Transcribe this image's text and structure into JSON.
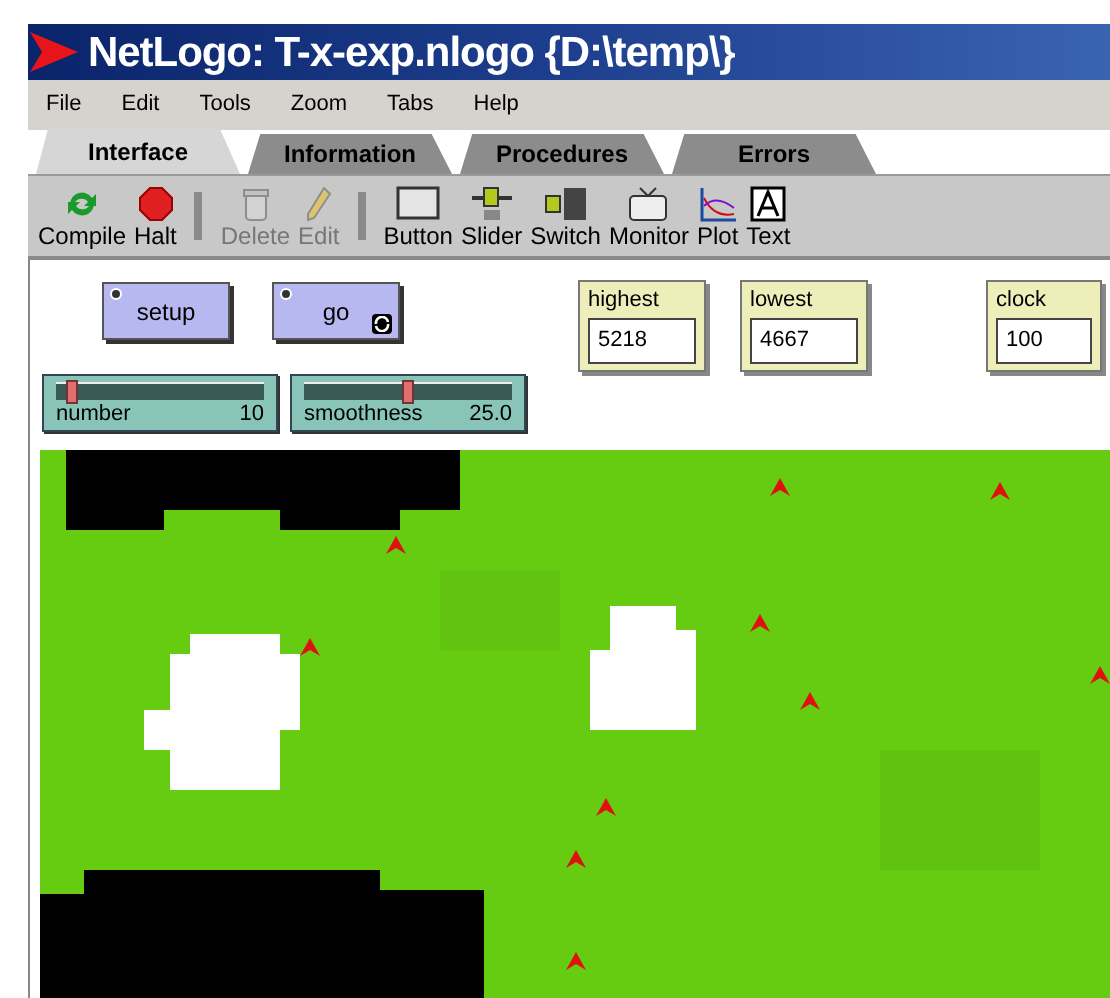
{
  "window": {
    "title": "NetLogo: T-x-exp.nlogo {D:\\temp\\}"
  },
  "menu": [
    "File",
    "Edit",
    "Tools",
    "Zoom",
    "Tabs",
    "Help"
  ],
  "tabs": [
    {
      "label": "Interface",
      "selected": true
    },
    {
      "label": "Information",
      "selected": false
    },
    {
      "label": "Procedures",
      "selected": false
    },
    {
      "label": "Errors",
      "selected": false
    }
  ],
  "toolbar_groups": [
    {
      "items": [
        {
          "label": "Compile",
          "disabled": false
        },
        {
          "label": "Halt",
          "disabled": false
        }
      ]
    },
    {
      "items": [
        {
          "label": "Delete",
          "disabled": true
        },
        {
          "label": "Edit",
          "disabled": true
        }
      ]
    },
    {
      "items": [
        {
          "label": "Button",
          "disabled": false
        },
        {
          "label": "Slider",
          "disabled": false
        },
        {
          "label": "Switch",
          "disabled": false
        },
        {
          "label": "Monitor",
          "disabled": false
        },
        {
          "label": "Plot",
          "disabled": false
        },
        {
          "label": "Text",
          "disabled": false
        }
      ]
    }
  ],
  "buttons": [
    {
      "label": "setup",
      "forever": false
    },
    {
      "label": "go",
      "forever": true
    }
  ],
  "monitors": [
    {
      "label": "highest",
      "value": "5218"
    },
    {
      "label": "lowest",
      "value": "4667"
    },
    {
      "label": "clock",
      "value": "100"
    }
  ],
  "sliders": [
    {
      "label": "number",
      "value": "10",
      "level": 0.08
    },
    {
      "label": "smoothness",
      "value": "25.0",
      "level": 0.5
    }
  ]
}
